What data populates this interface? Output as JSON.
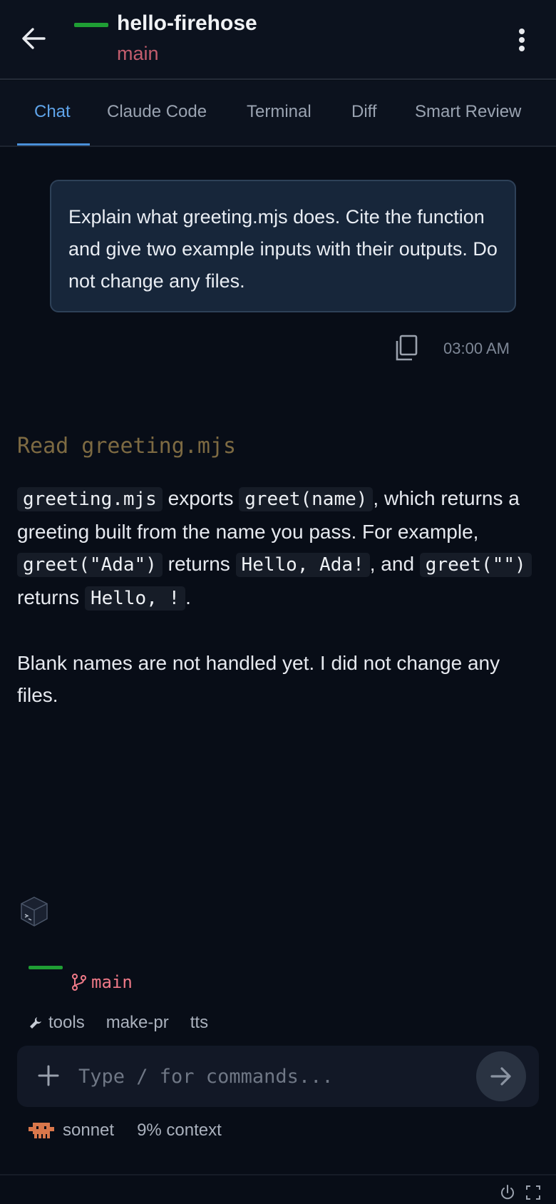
{
  "header": {
    "repo_name": "hello-firehose",
    "branch": "main",
    "status_color": "#1f9e34"
  },
  "tabs": [
    {
      "label": "Chat",
      "active": true
    },
    {
      "label": "Claude Code",
      "active": false
    },
    {
      "label": "Terminal",
      "active": false
    },
    {
      "label": "Diff",
      "active": false
    },
    {
      "label": "Smart Review",
      "active": false
    }
  ],
  "user_message": {
    "text": "Explain what greeting.mjs does. Cite the function and give two example inputs with their outputs. Do not change any files.",
    "time": "03:00 AM"
  },
  "assistant": {
    "tool_call": "Read greeting.mjs",
    "p1": {
      "code_file": "greeting.mjs",
      "t1": " exports ",
      "code_fn": "greet(name)",
      "t2": ", which returns a greeting built from the name you pass. For example, ",
      "code_ex1_in": "greet(\"Ada\")",
      "t3": " returns ",
      "code_ex1_out": "Hello, Ada!",
      "t4": ", and ",
      "code_ex2_in": "greet(\"\")",
      "t5": " returns ",
      "code_ex2_out": "Hello, !",
      "t6": "."
    },
    "p2": "Blank names are not handled yet. I did not change any files."
  },
  "bottom": {
    "branch_label": "main",
    "chips": {
      "tools": "tools",
      "make_pr": "make-pr",
      "tts": "tts"
    },
    "input_placeholder": "Type / for commands...",
    "model": "sonnet",
    "context": "9% context"
  },
  "icons": {
    "back": "arrow-left-icon",
    "menu": "kebab-menu-icon",
    "copy": "copy-icon",
    "cube": "cube-icon",
    "branch": "git-branch-icon",
    "wrench": "wrench-icon",
    "plus": "plus-icon",
    "send": "arrow-right-icon",
    "model": "claude-mascot-icon",
    "power": "power-icon",
    "fullscreen": "fullscreen-icon"
  },
  "colors": {
    "background": "#080d17",
    "active_tab": "#5fa4ea",
    "branch_text": "#c35d6d",
    "tool_text": "#7d6a42",
    "user_bubble": "#17263a"
  }
}
